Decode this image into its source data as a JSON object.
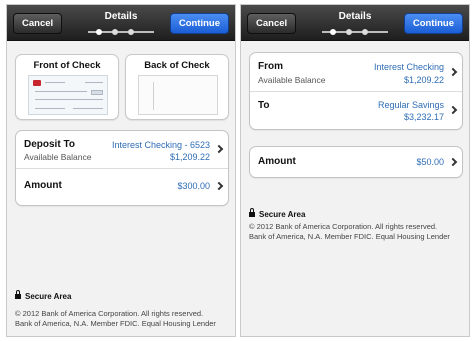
{
  "left_screen": {
    "nav": {
      "cancel_label": "Cancel",
      "title": "Details",
      "continue_label": "Continue"
    },
    "check_images": {
      "front_label": "Front of Check",
      "back_label": "Back of Check"
    },
    "deposit": {
      "title": "Deposit To",
      "account": "Interest Checking - 6523",
      "available_label": "Available Balance",
      "available_value": "$1,209.22"
    },
    "amount": {
      "title": "Amount",
      "value": "$300.00"
    },
    "secure_label": "Secure Area",
    "footer_line1": "© 2012  Bank of America Corporation. All rights reserved.",
    "footer_line2": "Bank of America, N.A. Member FDIC. Equal Housing Lender"
  },
  "right_screen": {
    "nav": {
      "cancel_label": "Cancel",
      "title": "Details",
      "continue_label": "Continue"
    },
    "from": {
      "title": "From",
      "account": "Interest Checking",
      "available_label": "Available Balance",
      "available_value": "$1,209.22"
    },
    "to": {
      "title": "To",
      "account": "Regular Savings",
      "value": "$3,232.17"
    },
    "amount": {
      "title": "Amount",
      "value": "$50.00"
    },
    "secure_label": "Secure Area",
    "footer_line1": "© 2012  Bank of America Corporation. All rights reserved.",
    "footer_line2": "Bank of America, N.A. Member FDIC. Equal Housing Lender"
  },
  "colors": {
    "accent_blue": "#2f6db5",
    "continue_button": "#1b5ed6",
    "navbar": "#2a2a2a",
    "logo_red": "#c8262f"
  },
  "icons": [
    "lock-icon",
    "chevron-right-icon",
    "progress-dot"
  ]
}
